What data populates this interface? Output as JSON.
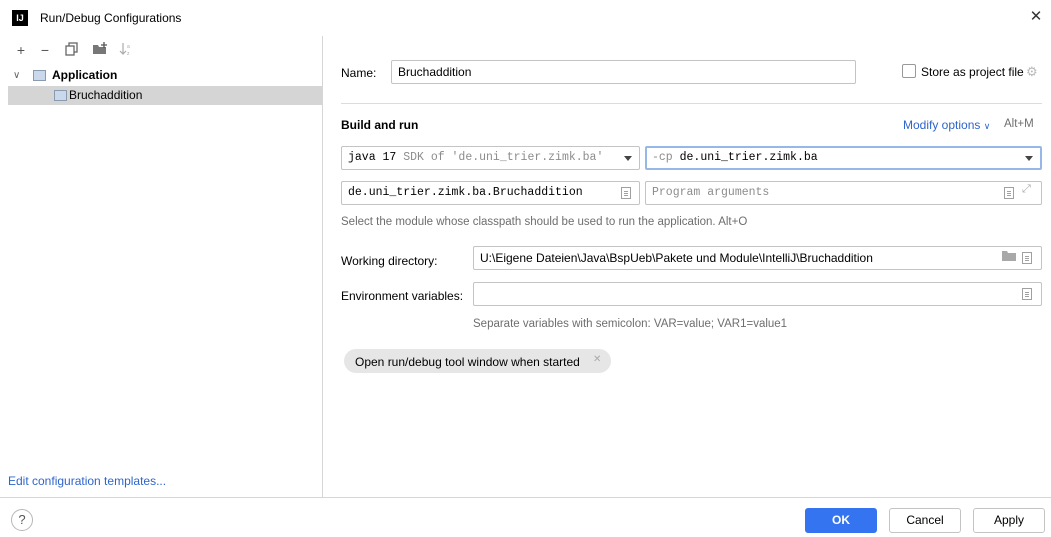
{
  "window": {
    "title": "Run/Debug Configurations",
    "logo_text": "IJ"
  },
  "left_panel": {
    "tree": [
      {
        "label": "Application",
        "expanded": true
      },
      {
        "label": "Bruchaddition",
        "selected": true
      }
    ],
    "edit_templates_link": "Edit configuration templates..."
  },
  "form": {
    "name_label": "Name:",
    "name_value": "Bruchaddition",
    "store_as_project_file": "Store as project file",
    "section_title": "Build and run",
    "modify_options": "Modify options",
    "modify_shortcut": "Alt+M",
    "sdk_java": "java 17",
    "sdk_detail": "SDK of 'de.uni_trier.zimk.ba'",
    "cp_prefix": "-cp",
    "cp_value": "de.uni_trier.zimk.ba",
    "main_class": "de.uni_trier.zimk.ba.Bruchaddition",
    "program_args_placeholder": "Program arguments",
    "module_hint": "Select the module whose classpath should be used to run the application. Alt+O",
    "working_dir_label": "Working directory:",
    "working_dir_value": "U:\\Eigene Dateien\\Java\\BspUeb\\Pakete und Module\\IntelliJ\\Bruchaddition",
    "env_label": "Environment variables:",
    "env_value": "",
    "env_hint": "Separate variables with semicolon: VAR=value; VAR1=value1",
    "open_tool_window": "Open run/debug tool window when started"
  },
  "buttons": {
    "help": "?",
    "ok": "OK",
    "cancel": "Cancel",
    "apply": "Apply"
  },
  "colors": {
    "accent": "#3574f0",
    "link": "#2f65ca",
    "selection": "#d5d5d5"
  }
}
